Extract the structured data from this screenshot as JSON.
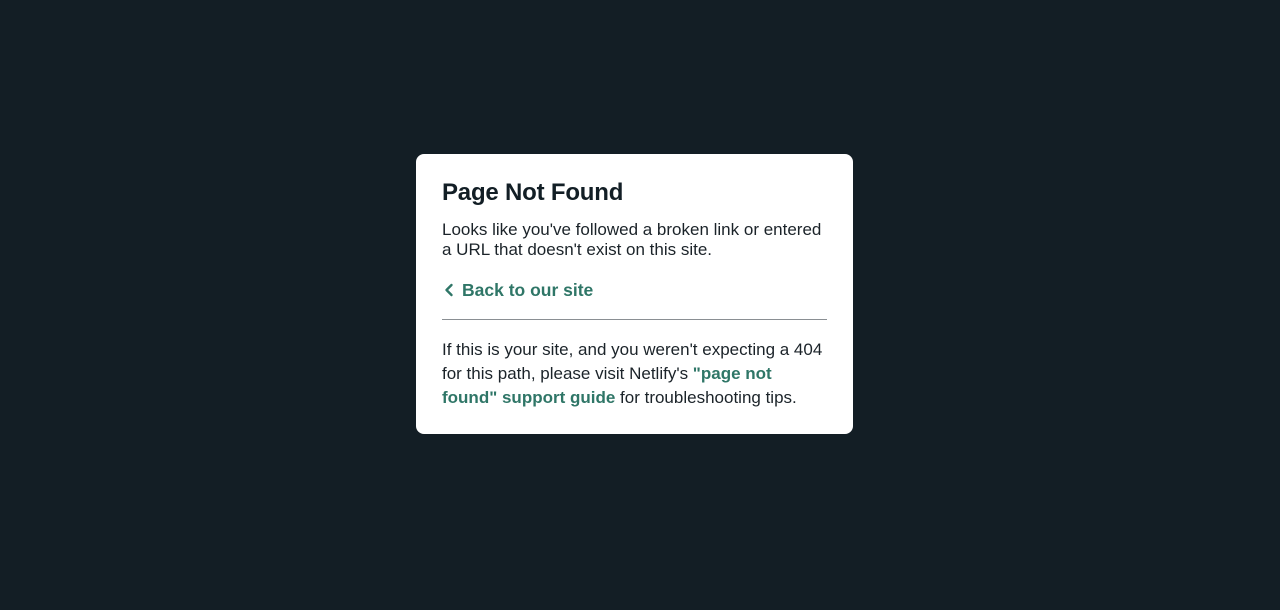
{
  "page": {
    "background_color": "#131e25",
    "accent_color": "#2f7667"
  },
  "card": {
    "title": "Page Not Found",
    "description": "Looks like you've followed a broken link or entered a URL that doesn't exist on this site.",
    "back_link": {
      "icon": "chevron-left-icon",
      "label": "Back to our site"
    },
    "footer": {
      "text_before": "If this is your site, and you weren't expecting a 404 for this path, please visit Netlify's ",
      "link_label": "\"page not found\" support guide",
      "text_after": " for troubleshooting tips."
    }
  }
}
